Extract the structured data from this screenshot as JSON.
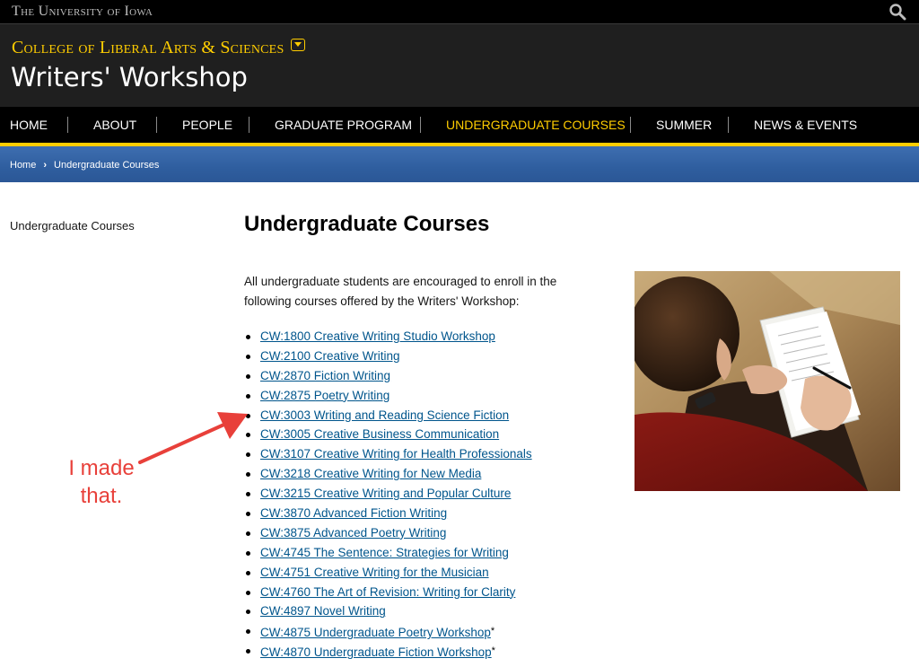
{
  "topbar": {
    "university": "The University of Iowa",
    "search_icon": "search-icon"
  },
  "header": {
    "college": "College of Liberal Arts & Sciences",
    "title": "Writers' Workshop"
  },
  "nav": {
    "items": [
      {
        "label": "HOME"
      },
      {
        "label": "ABOUT"
      },
      {
        "label": "PEOPLE"
      },
      {
        "label": "GRADUATE PROGRAM"
      },
      {
        "label": "UNDERGRADUATE COURSES",
        "active": true
      },
      {
        "label": "SUMMER"
      },
      {
        "label": "NEWS & EVENTS"
      }
    ]
  },
  "breadcrumb": {
    "home": "Home",
    "current": "Undergraduate Courses"
  },
  "sidebar": {
    "link": "Undergraduate Courses"
  },
  "main": {
    "title": "Undergraduate Courses",
    "intro": "All undergraduate students are encouraged to enroll in the following courses offered by the Writers' Workshop:",
    "courses": [
      {
        "label": "CW:1800 Creative Writing Studio Workshop"
      },
      {
        "label": "CW:2100 Creative Writing"
      },
      {
        "label": "CW:2870 Fiction Writing"
      },
      {
        "label": "CW:2875 Poetry Writing"
      },
      {
        "label": "CW:3003 Writing and Reading Science Fiction"
      },
      {
        "label": "CW:3005 Creative Business Communication"
      },
      {
        "label": "CW:3107 Creative Writing for Health Professionals"
      },
      {
        "label": "CW:3218 Creative Writing for New Media"
      },
      {
        "label": "CW:3215 Creative Writing and Popular Culture"
      },
      {
        "label": "CW:3870 Advanced Fiction Writing"
      },
      {
        "label": "CW:3875 Advanced Poetry Writing"
      },
      {
        "label": "CW:4745 The Sentence: Strategies for Writing"
      },
      {
        "label": "CW:4751 Creative Writing for the Musician"
      },
      {
        "label": "CW:4760 The Art of Revision: Writing for Clarity"
      },
      {
        "label": "CW:4897 Novel Writing"
      },
      {
        "label": "CW:4875 Undergraduate Poetry Workshop",
        "note": "*"
      },
      {
        "label": "CW:4870 Undergraduate Fiction Workshop",
        "note": "*"
      }
    ]
  },
  "annotation": {
    "line1": "I made",
    "line2": "that."
  },
  "colors": {
    "gold": "#ffcd00",
    "link": "#00558c",
    "annotation": "#e8403a",
    "band": "#3e6eb0"
  }
}
